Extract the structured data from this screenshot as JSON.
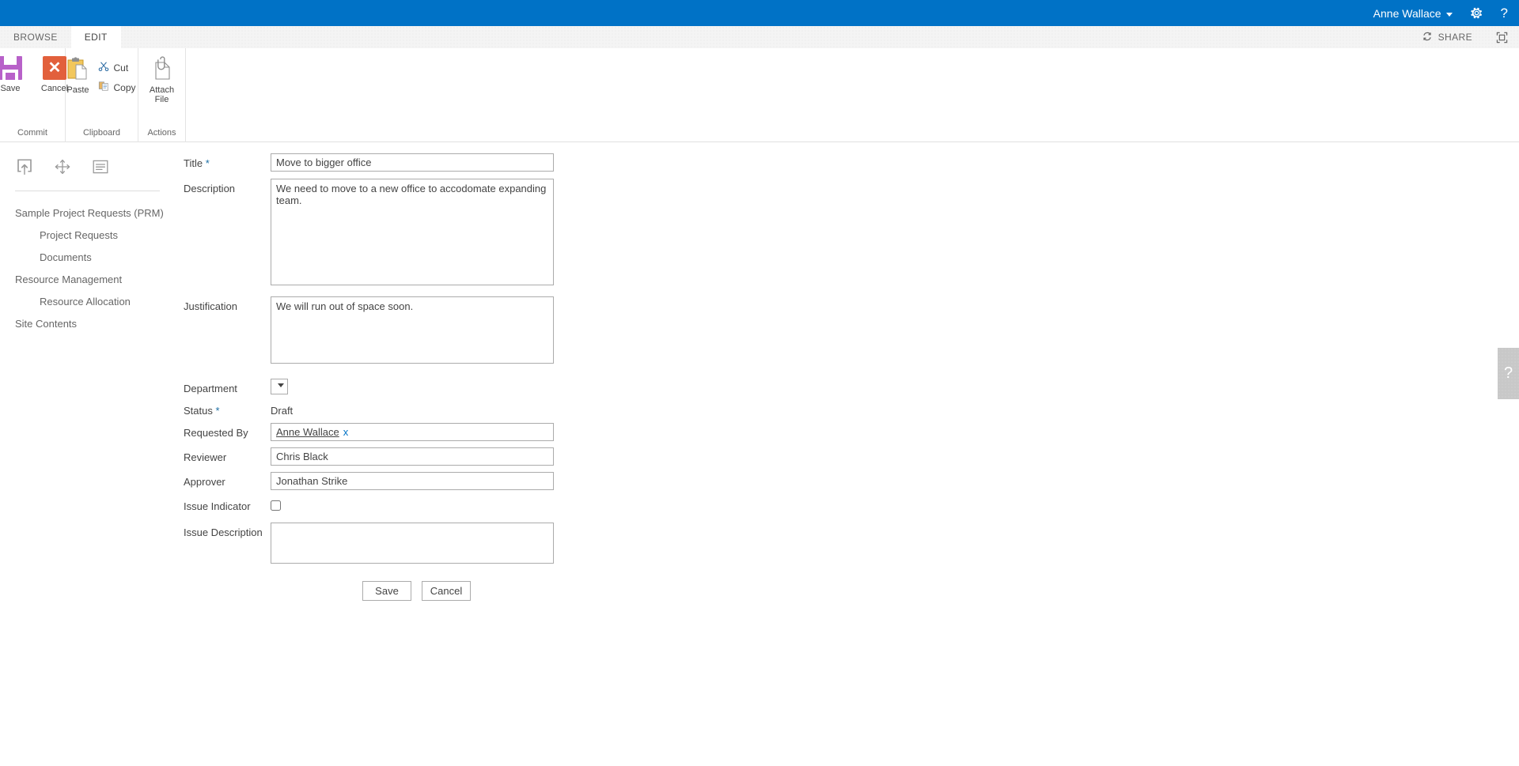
{
  "suite_bar": {
    "user_name": "Anne Wallace",
    "settings_icon": "gear-icon",
    "help_icon": "question-mark-icon"
  },
  "ribbon": {
    "tabs": [
      {
        "label": "BROWSE",
        "active": false
      },
      {
        "label": "EDIT",
        "active": true
      }
    ],
    "share_label": "SHARE",
    "focus_icon": "focus-on-content-icon",
    "groups": [
      {
        "label": "Commit",
        "items": [
          {
            "label": "Save",
            "icon": "save-floppy-icon"
          },
          {
            "label": "Cancel",
            "icon": "cancel-x-icon"
          }
        ]
      },
      {
        "label": "Clipboard",
        "items": [
          {
            "label": "Paste",
            "icon": "paste-clipboard-icon"
          },
          {
            "label": "Cut",
            "icon": "scissors-icon"
          },
          {
            "label": "Copy",
            "icon": "copy-pages-icon"
          }
        ]
      },
      {
        "label": "Actions",
        "items": [
          {
            "label": "Attach File",
            "label_line1": "Attach",
            "label_line2": "File",
            "icon": "paperclip-document-icon"
          }
        ]
      }
    ]
  },
  "left_nav": {
    "icons": [
      {
        "name": "upload-box-icon"
      },
      {
        "name": "move-arrows-icon"
      },
      {
        "name": "list-lines-icon"
      }
    ],
    "items": [
      {
        "label": "Sample Project Requests (PRM)",
        "level": 0
      },
      {
        "label": "Project Requests",
        "level": 1
      },
      {
        "label": "Documents",
        "level": 1
      },
      {
        "label": "Resource Management",
        "level": 0
      },
      {
        "label": "Resource Allocation",
        "level": 1
      },
      {
        "label": "Site Contents",
        "level": 0
      }
    ]
  },
  "form": {
    "title": {
      "label": "Title",
      "required": true,
      "value": "Move to bigger office"
    },
    "description": {
      "label": "Description",
      "required": false,
      "value": "We need to move to a new office to accodomate expanding team."
    },
    "justification": {
      "label": "Justification",
      "required": false,
      "value": "We will run out of space soon."
    },
    "department": {
      "label": "Department",
      "required": false,
      "value": "",
      "options": [
        ""
      ]
    },
    "status": {
      "label": "Status",
      "required": true,
      "value": "Draft"
    },
    "requested_by": {
      "label": "Requested By",
      "required": false,
      "value": "Anne Wallace",
      "remove_label": "x"
    },
    "reviewer": {
      "label": "Reviewer",
      "required": false,
      "value": "Chris Black"
    },
    "approver": {
      "label": "Approver",
      "required": false,
      "value": "Jonathan Strike"
    },
    "issue_indicator": {
      "label": "Issue Indicator",
      "required": false,
      "checked": false
    },
    "issue_description": {
      "label": "Issue Description",
      "required": false,
      "value": ""
    },
    "save_button": "Save",
    "cancel_button": "Cancel",
    "required_marker": "*"
  },
  "help_tab": {
    "glyph": "?"
  },
  "colors": {
    "suite_bar": "#0072C6",
    "accent": "#0072C6",
    "save_icon": "#B861C9",
    "cancel_icon": "#E2603C",
    "text": "#444444",
    "muted_text": "#666666",
    "field_border": "#ababab"
  }
}
